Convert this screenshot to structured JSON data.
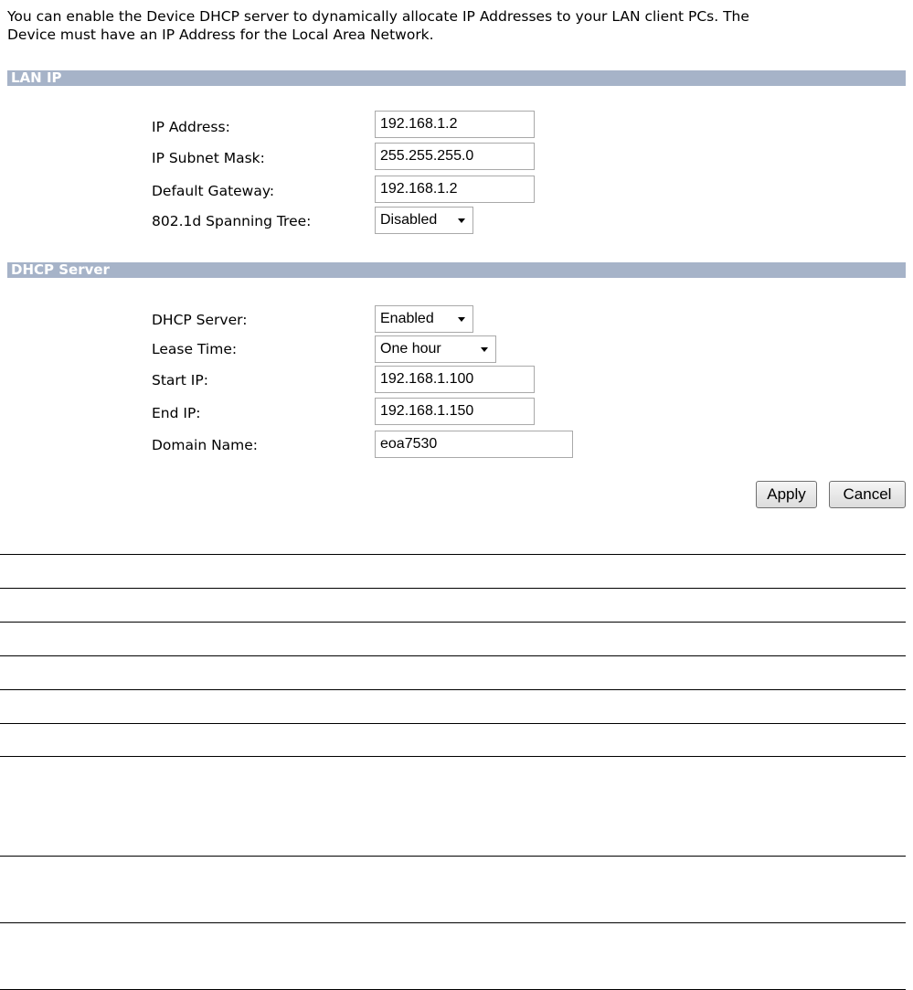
{
  "intro": {
    "line1": "You can enable the Device DHCP server to dynamically allocate IP Addresses to your LAN client PCs. The",
    "line2": "Device must have an IP Address for the Local Area Network."
  },
  "lan_ip": {
    "section_title": "LAN IP",
    "ip_address_label": "IP Address:",
    "ip_address_value": "192.168.1.2",
    "subnet_mask_label": "IP Subnet Mask:",
    "subnet_mask_value": "255.255.255.0",
    "gateway_label": "Default Gateway:",
    "gateway_value": "192.168.1.2",
    "spanning_tree_label": "802.1d Spanning Tree:",
    "spanning_tree_value": "Disabled"
  },
  "dhcp": {
    "section_title": "DHCP Server",
    "server_label": "DHCP Server:",
    "server_value": "Enabled",
    "lease_label": "Lease Time:",
    "lease_value": "One hour",
    "start_ip_label": "Start IP:",
    "start_ip_value": "192.168.1.100",
    "end_ip_label": "End IP:",
    "end_ip_value": "192.168.1.150",
    "domain_label": "Domain Name:",
    "domain_value": "eoa7530"
  },
  "buttons": {
    "apply": "Apply",
    "cancel": "Cancel"
  },
  "colors": {
    "section_bar": "#a6b3c8",
    "section_text": "#ffffff"
  }
}
